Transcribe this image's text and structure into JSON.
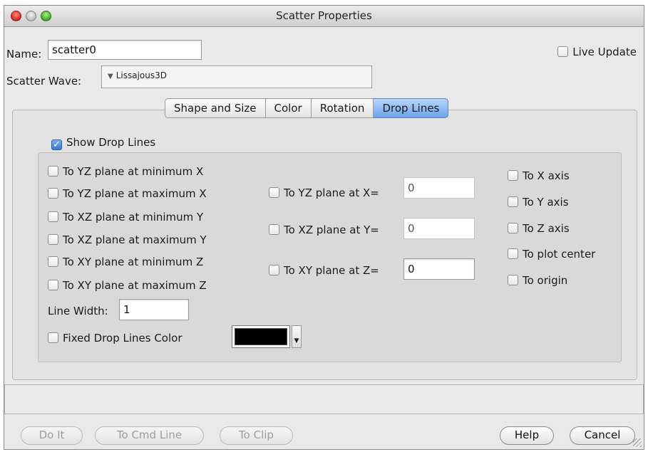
{
  "window": {
    "title": "Scatter Properties"
  },
  "name_label": "Name:",
  "name_value": "scatter0",
  "live_update_label": "Live Update",
  "scatter_wave_label": "Scatter Wave:",
  "scatter_wave_value": "Lissajous3D",
  "tabs": [
    "Shape and Size",
    "Color",
    "Rotation",
    "Drop Lines"
  ],
  "active_tab": "Drop Lines",
  "show_drop_lines_label": "Show Drop Lines",
  "show_drop_lines_checked": true,
  "left_options": [
    "To YZ plane at minimum X",
    "To YZ plane at maximum X",
    "To XZ plane at minimum Y",
    "To XZ plane at maximum Y",
    "To XY plane at minimum Z",
    "To XY plane at maximum Z"
  ],
  "mid_options": [
    {
      "label": "To YZ plane at X=",
      "value": "0"
    },
    {
      "label": "To XZ plane at Y=",
      "value": "0"
    },
    {
      "label": "To XY plane at Z=",
      "value": "0"
    }
  ],
  "right_options": [
    "To X axis",
    "To Y axis",
    "To Z axis",
    "To plot center",
    "To origin"
  ],
  "line_width_label": "Line Width:",
  "line_width_value": "1",
  "fixed_color_label": "Fixed Drop Lines Color",
  "fixed_color_value": "#000000",
  "buttons": {
    "do_it": "Do It",
    "to_cmd_line": "To Cmd Line",
    "to_clip": "To Clip",
    "help": "Help",
    "cancel": "Cancel"
  }
}
